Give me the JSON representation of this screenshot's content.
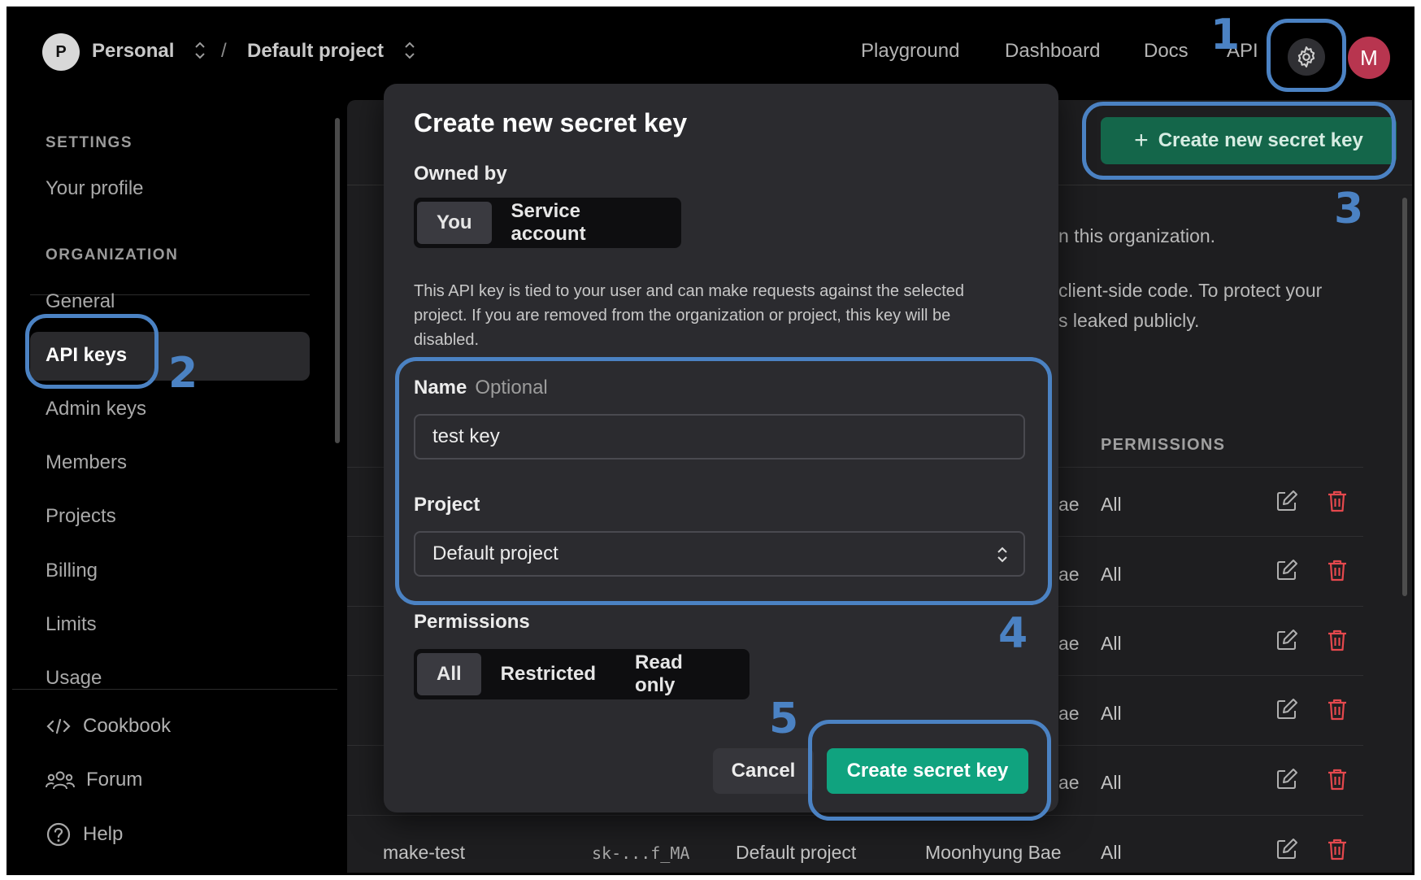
{
  "header": {
    "org_initial": "P",
    "org_name": "Personal",
    "separator": "/",
    "project_name": "Default project",
    "nav": [
      "Playground",
      "Dashboard",
      "Docs",
      "API"
    ],
    "user_initial": "M"
  },
  "sidebar": {
    "settings_heading": "SETTINGS",
    "profile": "Your profile",
    "org_heading": "ORGANIZATION",
    "items": [
      "General",
      "API keys",
      "Admin keys",
      "Members",
      "Projects",
      "Billing",
      "Limits",
      "Usage"
    ],
    "footer": [
      "Cookbook",
      "Forum",
      "Help"
    ]
  },
  "main": {
    "create_button": "Create new secret key",
    "text_fragments": [
      "n this organization.",
      "client-side code. To protect your",
      "s leaked publicly."
    ],
    "permissions_header": "PERMISSIONS",
    "rows": [
      {
        "owner_tail": "ae",
        "perm": "All"
      },
      {
        "owner_tail": "ae",
        "perm": "All"
      },
      {
        "owner_tail": "ae",
        "perm": "All"
      },
      {
        "owner_tail": "ae",
        "perm": "All"
      },
      {
        "owner_tail": "ae",
        "perm": "All"
      },
      {
        "name": "make-test",
        "key": "sk-...f_MA",
        "project": "Default project",
        "owner": "Moonhyung Bae",
        "perm": "All"
      }
    ]
  },
  "modal": {
    "title": "Create new secret key",
    "owned_by_label": "Owned by",
    "owned_by_options": [
      "You",
      "Service account"
    ],
    "owned_by_selected": "You",
    "description": "This API key is tied to your user and can make requests against the selected project. If you are removed from the organization or project, this key will be disabled.",
    "name_label": "Name",
    "name_optional": "Optional",
    "name_value": "test key",
    "project_label": "Project",
    "project_value": "Default project",
    "permissions_label": "Permissions",
    "permission_options": [
      "All",
      "Restricted",
      "Read only"
    ],
    "permission_selected": "All",
    "cancel_label": "Cancel",
    "create_label": "Create secret key"
  },
  "annotations": [
    "1",
    "2",
    "3",
    "4",
    "5"
  ],
  "colors": {
    "accent_green": "#10a37f",
    "annotation_blue": "#4b82c3",
    "avatar_red": "#b8354f",
    "delete_red": "#e5484d"
  }
}
